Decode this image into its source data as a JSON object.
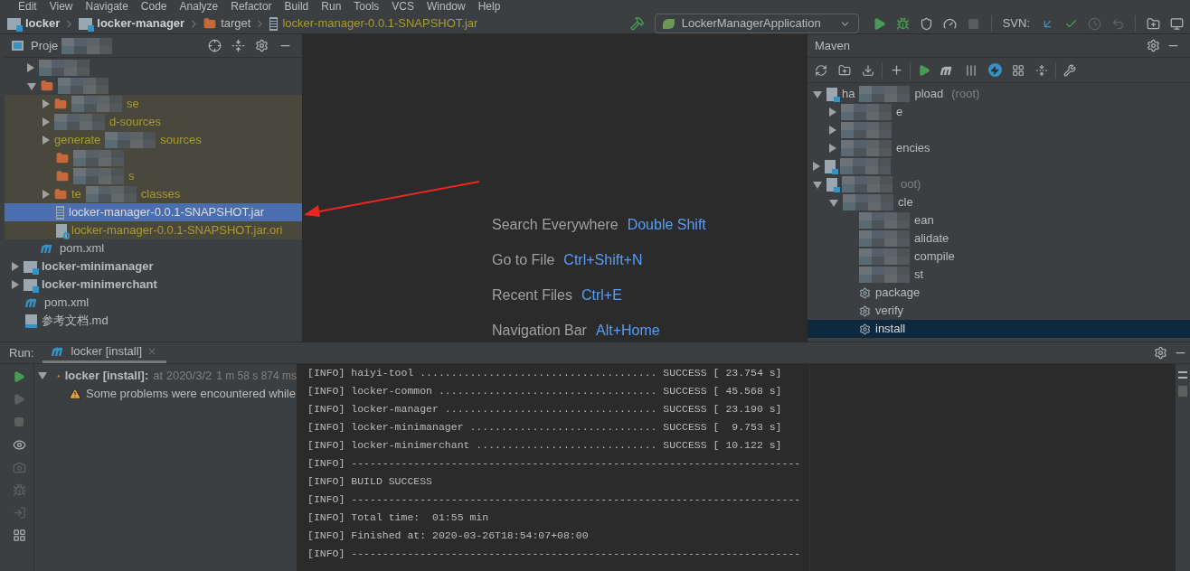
{
  "menu": [
    "Edit",
    "View",
    "Navigate",
    "Code",
    "Analyze",
    "Refactor",
    "Build",
    "Run",
    "Tools",
    "VCS",
    "Window",
    "Help"
  ],
  "breadcrumbs": [
    {
      "kind": "module",
      "label": "locker"
    },
    {
      "kind": "module",
      "label": "locker-manager"
    },
    {
      "kind": "folder",
      "label": "target"
    },
    {
      "kind": "jar",
      "label": "locker-manager-0.0.1-SNAPSHOT.jar"
    }
  ],
  "run_config": {
    "name": "LockerManagerApplication"
  },
  "svn_label": "SVN:",
  "project_panel": {
    "title": "Proje",
    "tree": [
      {
        "children": [
          {
            "expanded": false,
            "parts": [
              {
                "kind": "mosaic"
              }
            ]
          },
          {
            "expanded": true,
            "kind": "folder",
            "parts": [
              {
                "kind": "mosaic"
              }
            ],
            "children": [
              {
                "expanded": false,
                "excluded": true,
                "kind": "folder",
                "parts": [
                  {
                    "kind": "mosaic"
                  },
                  {
                    "kind": "text",
                    "text": "se"
                  }
                ]
              },
              {
                "expanded": false,
                "excluded": true,
                "parts": [
                  {
                    "kind": "mosaic"
                  },
                  {
                    "kind": "text",
                    "text": "d-sources"
                  }
                ]
              },
              {
                "expanded": false,
                "excluded": true,
                "parts": [
                  {
                    "kind": "text",
                    "text": "generate"
                  },
                  {
                    "kind": "mosaic"
                  },
                  {
                    "kind": "text",
                    "text": "sources"
                  }
                ]
              },
              {
                "excluded": true,
                "kind": "folder",
                "parts": [
                  {
                    "kind": "mosaic"
                  }
                ]
              },
              {
                "excluded": true,
                "kind": "folder",
                "parts": [
                  {
                    "kind": "mosaic"
                  },
                  {
                    "kind": "text",
                    "text": "s"
                  }
                ]
              },
              {
                "expanded": false,
                "excluded": true,
                "kind": "folder",
                "parts": [
                  {
                    "kind": "text",
                    "text": "te"
                  },
                  {
                    "kind": "mosaic"
                  },
                  {
                    "kind": "text",
                    "text": "classes"
                  }
                ]
              },
              {
                "selected": true,
                "kind": "jar",
                "parts": [
                  {
                    "kind": "text",
                    "text": "locker-manager-0.0.1-SNAPSHOT.jar"
                  }
                ]
              },
              {
                "selected": false,
                "excluded": true,
                "kind": "unknown",
                "parts": [
                  {
                    "kind": "text",
                    "text": "locker-manager-0.0.1-SNAPSHOT.jar.ori"
                  }
                ]
              }
            ]
          },
          {
            "kind": "maven",
            "parts": [
              {
                "kind": "text",
                "text": "pom.xml"
              }
            ]
          }
        ]
      },
      {
        "expanded": false,
        "kind": "module",
        "bold": true,
        "parts": [
          {
            "kind": "text",
            "text": "locker-minimanager"
          }
        ]
      },
      {
        "expanded": false,
        "kind": "module",
        "bold": true,
        "parts": [
          {
            "kind": "text",
            "text": "locker-minimerchant"
          }
        ]
      },
      {
        "kind": "maven",
        "parts": [
          {
            "kind": "text",
            "text": "pom.xml"
          }
        ]
      },
      {
        "kind": "md",
        "parts": [
          {
            "kind": "text",
            "text": "参考文档.md"
          }
        ]
      }
    ]
  },
  "editor": {
    "hints": [
      {
        "action": "Search Everywhere",
        "shortcut": "Double Shift"
      },
      {
        "action": "Go to File",
        "shortcut": "Ctrl+Shift+N"
      },
      {
        "action": "Recent Files",
        "shortcut": "Ctrl+E"
      },
      {
        "action": "Navigation Bar",
        "shortcut": "Alt+Home"
      }
    ]
  },
  "maven": {
    "title": "Maven",
    "tree": [
      {
        "expanded": true,
        "kind": "maven-root",
        "parts": [
          {
            "kind": "text",
            "text": "ha"
          },
          {
            "kind": "mosaic"
          },
          {
            "kind": "text",
            "text": "pload"
          },
          {
            "kind": "hint",
            "text": "(root)"
          }
        ],
        "children": [
          {
            "expanded": false,
            "parts": [
              {
                "kind": "mosaic"
              },
              {
                "kind": "text",
                "text": "e"
              }
            ]
          },
          {
            "expanded": false,
            "parts": [
              {
                "kind": "mosaic"
              }
            ]
          },
          {
            "expanded": false,
            "parts": [
              {
                "kind": "mosaic"
              },
              {
                "kind": "text",
                "text": "encies"
              }
            ]
          }
        ]
      },
      {
        "expanded": false,
        "kind": "maven-root",
        "parts": [
          {
            "kind": "mosaic"
          }
        ]
      },
      {
        "expanded": true,
        "kind": "maven-root",
        "parts": [
          {
            "kind": "mosaic"
          },
          {
            "kind": "hint",
            "text": "oot)"
          }
        ],
        "children": [
          {
            "expanded": true,
            "parts": [
              {
                "kind": "mosaic"
              },
              {
                "kind": "text",
                "text": "cle"
              }
            ],
            "children": [
              {
                "selected": false,
                "parts": [
                  {
                    "kind": "mosaic"
                  },
                  {
                    "kind": "text",
                    "text": "ean"
                  }
                ]
              },
              {
                "selected": false,
                "parts": [
                  {
                    "kind": "mosaic"
                  },
                  {
                    "kind": "text",
                    "text": "alidate"
                  }
                ]
              },
              {
                "selected": false,
                "parts": [
                  {
                    "kind": "mosaic"
                  },
                  {
                    "kind": "text",
                    "text": "compile"
                  }
                ]
              },
              {
                "selected": false,
                "parts": [
                  {
                    "kind": "mosaic"
                  },
                  {
                    "kind": "text",
                    "text": "st"
                  }
                ]
              },
              {
                "selected": false,
                "kind": "gear",
                "parts": [
                  {
                    "kind": "text",
                    "text": "package"
                  }
                ]
              },
              {
                "selected": false,
                "kind": "gear",
                "parts": [
                  {
                    "kind": "text",
                    "text": "verify"
                  }
                ]
              },
              {
                "selected": true,
                "kind": "gear",
                "parts": [
                  {
                    "kind": "text",
                    "text": "install"
                  }
                ]
              }
            ]
          }
        ]
      }
    ]
  },
  "run_panel": {
    "label": "Run:",
    "tabs": [
      {
        "label": "locker [install]",
        "selected": true
      }
    ],
    "tree": {
      "title": "locker [install]:",
      "detail": "at 2020/3/2",
      "duration": "1 m 58 s 874 ms",
      "children": [
        {
          "text": "Some problems were encountered while"
        }
      ]
    },
    "console": [
      "[INFO] haiyi-tool ...................................... SUCCESS [ 23.754 s]",
      "[INFO] locker-common ................................... SUCCESS [ 45.568 s]",
      "[INFO] locker-manager .................................. SUCCESS [ 23.190 s]",
      "[INFO] locker-minimanager .............................. SUCCESS [  9.753 s]",
      "[INFO] locker-minimerchant ............................. SUCCESS [ 10.122 s]",
      "[INFO] ------------------------------------------------------------------------",
      "[INFO] BUILD SUCCESS",
      "[INFO] ------------------------------------------------------------------------",
      "[INFO] Total time:  01:55 min",
      "[INFO] Finished at: 2020-03-26T18:54:07+08:00",
      "[INFO] ------------------------------------------------------------------------"
    ]
  }
}
